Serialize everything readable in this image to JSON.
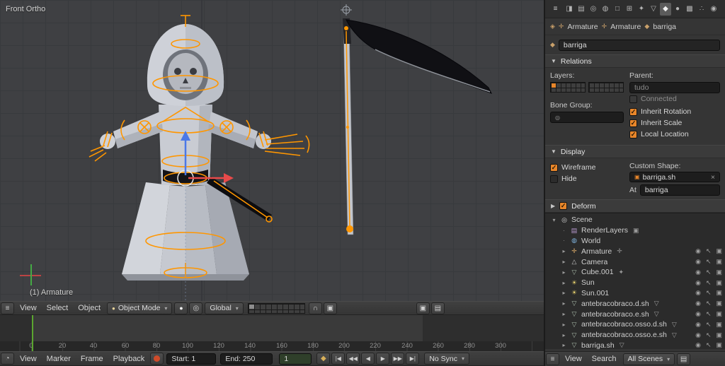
{
  "colors": {
    "accent_orange": "#e8862a",
    "armature_orange": "#ff9600",
    "frame_green": "#5ba52f"
  },
  "viewport": {
    "view_label": "Front Ortho",
    "object_label": "(1) Armature"
  },
  "view3d_header": {
    "menus": [
      "View",
      "Select",
      "Object"
    ],
    "mode": "Object Mode",
    "orientation": "Global"
  },
  "timeline": {
    "menus": [
      "View",
      "Marker",
      "Frame",
      "Playback"
    ],
    "start": "Start: 1",
    "end": "End: 250",
    "current_frame": "1",
    "sync": "No Sync",
    "buttons": [
      "|◀",
      "◀◀",
      "◀",
      "▶",
      "▶▶",
      "▶|"
    ],
    "ticks": [
      "0",
      "20",
      "40",
      "60",
      "80",
      "100",
      "120",
      "140",
      "160",
      "180",
      "200",
      "220",
      "240",
      "260",
      "280",
      "300"
    ]
  },
  "properties": {
    "tabs": [
      {
        "name": "render",
        "glyph": "◨"
      },
      {
        "name": "render-layers",
        "glyph": "▤"
      },
      {
        "name": "scene",
        "glyph": "◎"
      },
      {
        "name": "world",
        "glyph": "◍"
      },
      {
        "name": "object",
        "glyph": "□"
      },
      {
        "name": "constraints",
        "glyph": "⊞"
      },
      {
        "name": "modifiers",
        "glyph": "✦"
      },
      {
        "name": "object-data",
        "glyph": "▽"
      },
      {
        "name": "bone",
        "glyph": "◆"
      },
      {
        "name": "material",
        "glyph": "●"
      },
      {
        "name": "texture",
        "glyph": "▩"
      },
      {
        "name": "particles",
        "glyph": "∴"
      },
      {
        "name": "physics",
        "glyph": "◉"
      }
    ],
    "breadcrumb": {
      "object": "Armature",
      "data": "Armature",
      "bone": "barriga"
    },
    "bone_name": "barriga",
    "relations": {
      "title": "Relations",
      "layers_label": "Layers:",
      "bone_group_label": "Bone Group:",
      "parent_label": "Parent:",
      "parent_value": "tudo",
      "connected_label": "Connected",
      "inherit_rotation": "Inherit Rotation",
      "inherit_scale": "Inherit Scale",
      "local_location": "Local Location"
    },
    "display": {
      "title": "Display",
      "wireframe_label": "Wireframe",
      "hide_label": "Hide",
      "custom_shape_label": "Custom Shape:",
      "custom_shape_value": "barriga.sh",
      "at_label": "At",
      "at_value": "barriga"
    },
    "deform": {
      "title": "Deform"
    }
  },
  "outliner": {
    "items": [
      {
        "expander": "▾",
        "glyph": "◎",
        "label": "Scene",
        "extra": ""
      },
      {
        "expander": "·",
        "glyph": "▤",
        "label": "RenderLayers",
        "extra": "▣"
      },
      {
        "expander": "·",
        "glyph": "◍",
        "label": "World",
        "extra": ""
      },
      {
        "expander": "▸",
        "glyph": "✛",
        "label": "Armature",
        "extra": "✛"
      },
      {
        "expander": "▸",
        "glyph": "△",
        "label": "Camera",
        "extra": ""
      },
      {
        "expander": "▸",
        "glyph": "▽",
        "label": "Cube.001",
        "extra": "✦"
      },
      {
        "expander": "▸",
        "glyph": "☀",
        "label": "Sun",
        "extra": ""
      },
      {
        "expander": "▸",
        "glyph": "☀",
        "label": "Sun.001",
        "extra": ""
      },
      {
        "expander": "▸",
        "glyph": "▽",
        "label": "antebracobraco.d.sh",
        "extra": "▽"
      },
      {
        "expander": "▸",
        "glyph": "▽",
        "label": "antebracobraco.e.sh",
        "extra": "▽"
      },
      {
        "expander": "▸",
        "glyph": "▽",
        "label": "antebracobraco.osso.d.sh",
        "extra": "▽"
      },
      {
        "expander": "▸",
        "glyph": "▽",
        "label": "antebracobraco.osso.e.sh",
        "extra": "▽"
      },
      {
        "expander": "▸",
        "glyph": "▽",
        "label": "barriga.sh",
        "extra": "▽"
      }
    ],
    "footer": {
      "menus": [
        "View",
        "Search"
      ],
      "scenes": "All Scenes"
    }
  },
  "icons": {
    "check": "✓",
    "chevron": "▾",
    "eye": "◉",
    "select": "↖",
    "render_toggle": "▣",
    "close": "×",
    "pin": "◈",
    "bone": "◆",
    "armature": "✛",
    "editor": "≡",
    "sphere": "●",
    "pivot": "◎",
    "magnet": "∩",
    "snap": "▣",
    "clock": "◔",
    "record": "",
    "camera1": "▣",
    "camera2": "▤",
    "key": "◆",
    "shape_obj": "▣"
  }
}
